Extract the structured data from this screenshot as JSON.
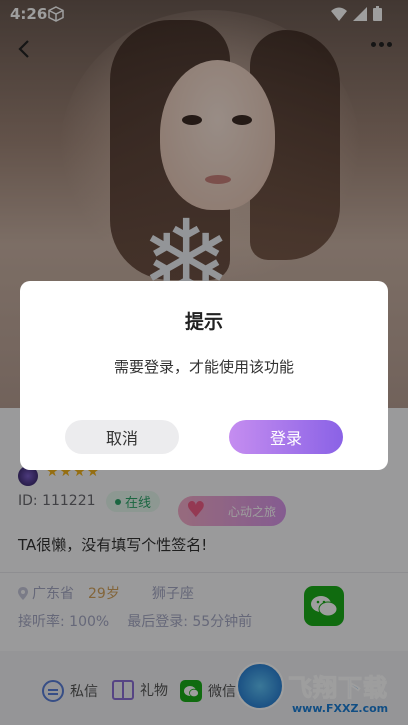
{
  "status_bar": {
    "time": "4:26"
  },
  "profile": {
    "stars": "★★★★",
    "id_text": "ID: 111221",
    "online_label": "在线",
    "heart_tag": "心动之旅",
    "signature": "TA很懒，没有填写个性签名!",
    "province": "广东省",
    "age": "29岁",
    "zodiac": "狮子座",
    "answer_rate": "接听率: 100%",
    "last_login": "最后登录: 55分钟前"
  },
  "actions": {
    "message": "私信",
    "gift": "礼物",
    "wechat": "微信"
  },
  "watermark": {
    "title": "飞翔下载",
    "url": "www.FXXZ.com"
  },
  "dialog": {
    "title": "提示",
    "message": "需要登录，才能使用该功能",
    "cancel": "取消",
    "login": "登录"
  },
  "colors": {
    "accent": "#8a62e6",
    "online": "#2da56a",
    "wechat": "#1aad19"
  }
}
